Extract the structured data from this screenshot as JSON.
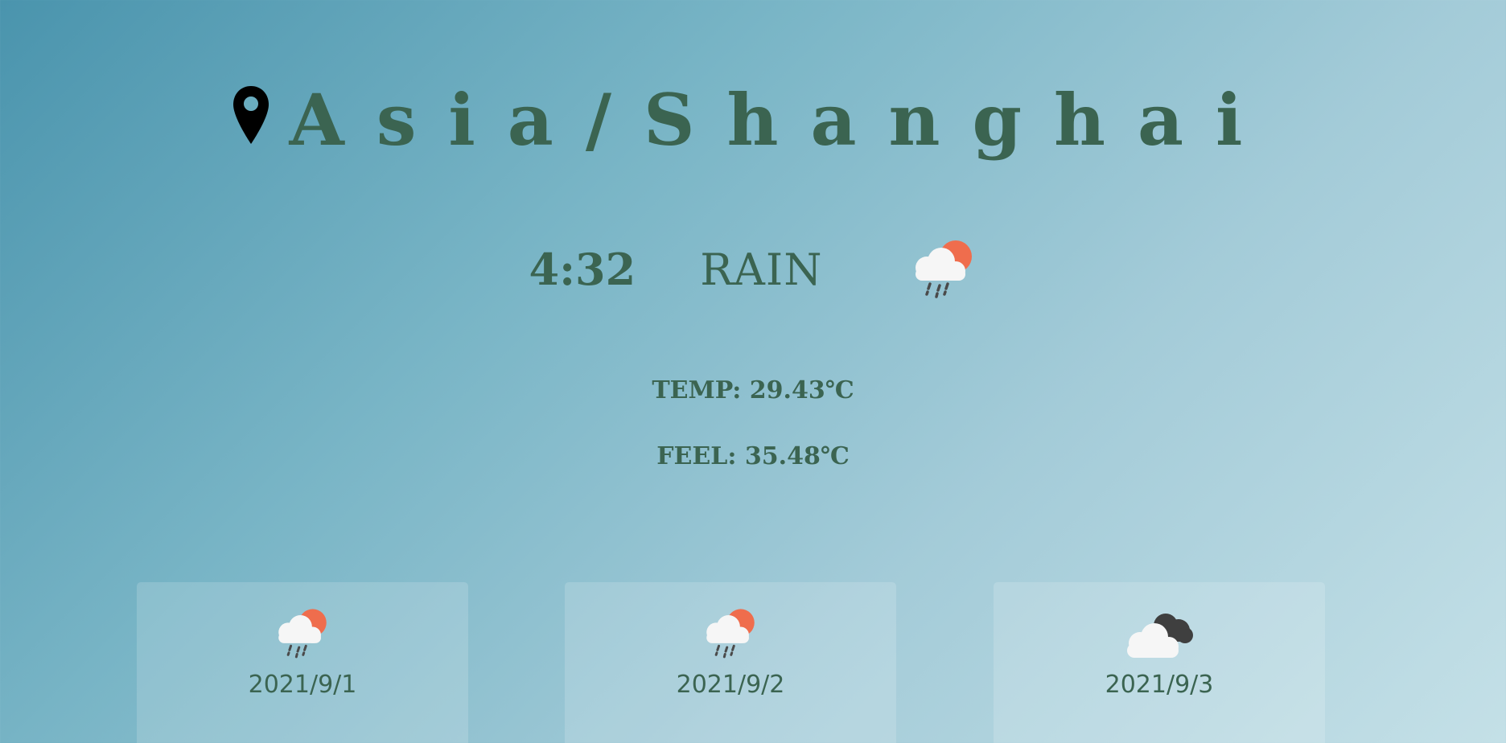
{
  "location": {
    "icon": "map-pin-icon",
    "city": "Asia/Shanghai"
  },
  "current": {
    "time": "4:32",
    "description": "RAIN",
    "icon": "sun-rain-cloud-icon",
    "temp": "TEMP: 29.43℃",
    "feel": "FEEL: 35.48℃"
  },
  "forecast": [
    {
      "date": "2021/9/1",
      "icon": "sun-rain-cloud-icon"
    },
    {
      "date": "2021/9/2",
      "icon": "sun-rain-cloud-icon"
    },
    {
      "date": "2021/9/3",
      "icon": "dark-cloud-icon"
    }
  ],
  "colors": {
    "text": "#3b6451",
    "sun": "#ef6d4d",
    "cloud": "#f6f6f6",
    "dark_cloud": "#3f3f3f"
  }
}
